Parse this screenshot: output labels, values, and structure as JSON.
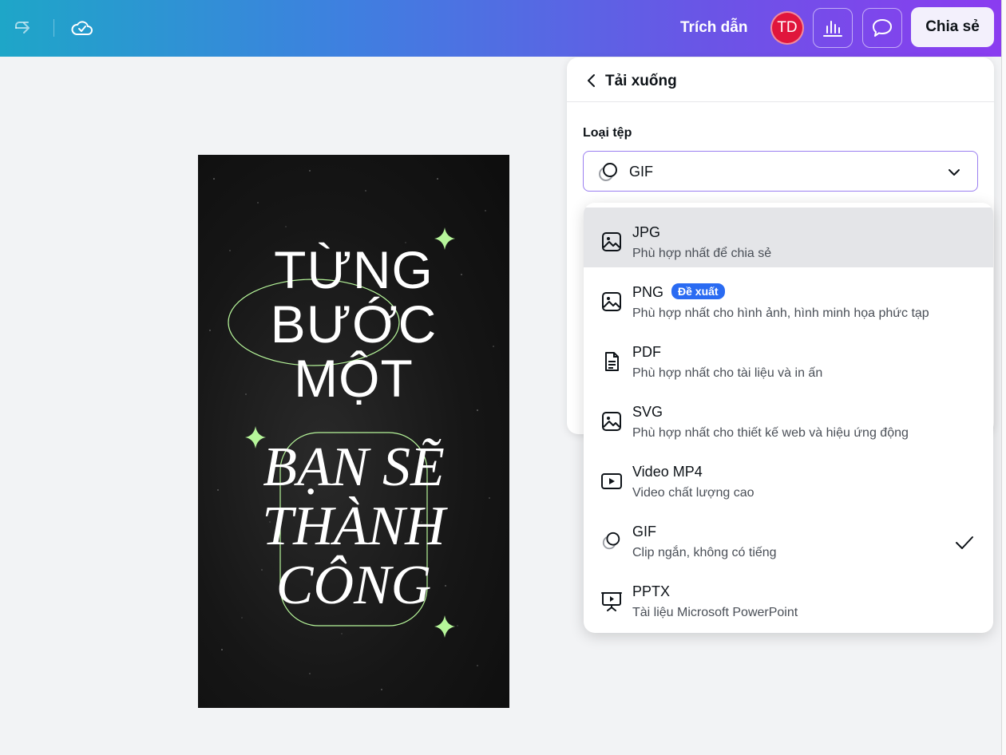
{
  "topbar": {
    "redo_icon": "redo-icon",
    "cloud_icon": "cloud-check-icon",
    "quote_label": "Trích dẫn",
    "avatar_initials": "TD",
    "avatar_color": "#e0163c",
    "insights_icon": "bar-chart-icon",
    "comments_icon": "comment-icon",
    "share_label": "Chia sẻ"
  },
  "design": {
    "line1": "TỪNG",
    "line2": "BƯỚC",
    "line3": "MỘT",
    "line4": "BẠN SẼ",
    "line5": "THÀNH",
    "line6": "CÔNG",
    "accent_color": "#b6f59a"
  },
  "panel": {
    "back_icon": "chevron-left-icon",
    "title": "Tải xuống",
    "file_type_label": "Loại tệp",
    "selected_value": "GIF",
    "selected_icon": "gif-icon",
    "chevron_icon": "chevron-down-icon"
  },
  "dropdown": {
    "options": [
      {
        "title": "JPG",
        "desc": "Phù hợp nhất để chia sẻ",
        "icon": "image-icon"
      },
      {
        "title": "PNG",
        "badge": "Đề xuất",
        "desc": "Phù hợp nhất cho hình ảnh, hình minh họa phức tạp",
        "icon": "image-icon"
      },
      {
        "title": "PDF",
        "desc": "Phù hợp nhất cho tài liệu và in ấn",
        "icon": "document-icon"
      },
      {
        "title": "SVG",
        "desc": "Phù hợp nhất cho thiết kế web và hiệu ứng động",
        "icon": "image-icon"
      },
      {
        "title": "Video MP4",
        "desc": "Video chất lượng cao",
        "icon": "video-icon"
      },
      {
        "title": "GIF",
        "desc": "Clip ngắn, không có tiếng",
        "icon": "gif-icon",
        "selected": true
      },
      {
        "title": "PPTX",
        "desc": "Tài liệu Microsoft PowerPoint",
        "icon": "presentation-icon"
      }
    ],
    "active_highlight": "#e4e5e8",
    "badge_color": "#2a6bf2"
  }
}
